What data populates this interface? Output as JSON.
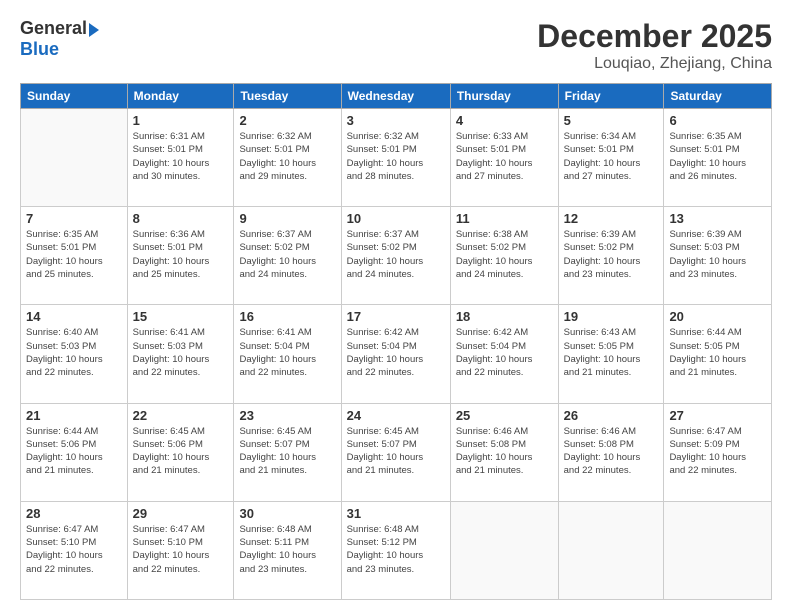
{
  "logo": {
    "general": "General",
    "blue": "Blue"
  },
  "title": "December 2025",
  "subtitle": "Louqiao, Zhejiang, China",
  "header_days": [
    "Sunday",
    "Monday",
    "Tuesday",
    "Wednesday",
    "Thursday",
    "Friday",
    "Saturday"
  ],
  "weeks": [
    [
      {
        "day": "",
        "info": ""
      },
      {
        "day": "1",
        "info": "Sunrise: 6:31 AM\nSunset: 5:01 PM\nDaylight: 10 hours\nand 30 minutes."
      },
      {
        "day": "2",
        "info": "Sunrise: 6:32 AM\nSunset: 5:01 PM\nDaylight: 10 hours\nand 29 minutes."
      },
      {
        "day": "3",
        "info": "Sunrise: 6:32 AM\nSunset: 5:01 PM\nDaylight: 10 hours\nand 28 minutes."
      },
      {
        "day": "4",
        "info": "Sunrise: 6:33 AM\nSunset: 5:01 PM\nDaylight: 10 hours\nand 27 minutes."
      },
      {
        "day": "5",
        "info": "Sunrise: 6:34 AM\nSunset: 5:01 PM\nDaylight: 10 hours\nand 27 minutes."
      },
      {
        "day": "6",
        "info": "Sunrise: 6:35 AM\nSunset: 5:01 PM\nDaylight: 10 hours\nand 26 minutes."
      }
    ],
    [
      {
        "day": "7",
        "info": "Sunrise: 6:35 AM\nSunset: 5:01 PM\nDaylight: 10 hours\nand 25 minutes."
      },
      {
        "day": "8",
        "info": "Sunrise: 6:36 AM\nSunset: 5:01 PM\nDaylight: 10 hours\nand 25 minutes."
      },
      {
        "day": "9",
        "info": "Sunrise: 6:37 AM\nSunset: 5:02 PM\nDaylight: 10 hours\nand 24 minutes."
      },
      {
        "day": "10",
        "info": "Sunrise: 6:37 AM\nSunset: 5:02 PM\nDaylight: 10 hours\nand 24 minutes."
      },
      {
        "day": "11",
        "info": "Sunrise: 6:38 AM\nSunset: 5:02 PM\nDaylight: 10 hours\nand 24 minutes."
      },
      {
        "day": "12",
        "info": "Sunrise: 6:39 AM\nSunset: 5:02 PM\nDaylight: 10 hours\nand 23 minutes."
      },
      {
        "day": "13",
        "info": "Sunrise: 6:39 AM\nSunset: 5:03 PM\nDaylight: 10 hours\nand 23 minutes."
      }
    ],
    [
      {
        "day": "14",
        "info": "Sunrise: 6:40 AM\nSunset: 5:03 PM\nDaylight: 10 hours\nand 22 minutes."
      },
      {
        "day": "15",
        "info": "Sunrise: 6:41 AM\nSunset: 5:03 PM\nDaylight: 10 hours\nand 22 minutes."
      },
      {
        "day": "16",
        "info": "Sunrise: 6:41 AM\nSunset: 5:04 PM\nDaylight: 10 hours\nand 22 minutes."
      },
      {
        "day": "17",
        "info": "Sunrise: 6:42 AM\nSunset: 5:04 PM\nDaylight: 10 hours\nand 22 minutes."
      },
      {
        "day": "18",
        "info": "Sunrise: 6:42 AM\nSunset: 5:04 PM\nDaylight: 10 hours\nand 22 minutes."
      },
      {
        "day": "19",
        "info": "Sunrise: 6:43 AM\nSunset: 5:05 PM\nDaylight: 10 hours\nand 21 minutes."
      },
      {
        "day": "20",
        "info": "Sunrise: 6:44 AM\nSunset: 5:05 PM\nDaylight: 10 hours\nand 21 minutes."
      }
    ],
    [
      {
        "day": "21",
        "info": "Sunrise: 6:44 AM\nSunset: 5:06 PM\nDaylight: 10 hours\nand 21 minutes."
      },
      {
        "day": "22",
        "info": "Sunrise: 6:45 AM\nSunset: 5:06 PM\nDaylight: 10 hours\nand 21 minutes."
      },
      {
        "day": "23",
        "info": "Sunrise: 6:45 AM\nSunset: 5:07 PM\nDaylight: 10 hours\nand 21 minutes."
      },
      {
        "day": "24",
        "info": "Sunrise: 6:45 AM\nSunset: 5:07 PM\nDaylight: 10 hours\nand 21 minutes."
      },
      {
        "day": "25",
        "info": "Sunrise: 6:46 AM\nSunset: 5:08 PM\nDaylight: 10 hours\nand 21 minutes."
      },
      {
        "day": "26",
        "info": "Sunrise: 6:46 AM\nSunset: 5:08 PM\nDaylight: 10 hours\nand 22 minutes."
      },
      {
        "day": "27",
        "info": "Sunrise: 6:47 AM\nSunset: 5:09 PM\nDaylight: 10 hours\nand 22 minutes."
      }
    ],
    [
      {
        "day": "28",
        "info": "Sunrise: 6:47 AM\nSunset: 5:10 PM\nDaylight: 10 hours\nand 22 minutes."
      },
      {
        "day": "29",
        "info": "Sunrise: 6:47 AM\nSunset: 5:10 PM\nDaylight: 10 hours\nand 22 minutes."
      },
      {
        "day": "30",
        "info": "Sunrise: 6:48 AM\nSunset: 5:11 PM\nDaylight: 10 hours\nand 23 minutes."
      },
      {
        "day": "31",
        "info": "Sunrise: 6:48 AM\nSunset: 5:12 PM\nDaylight: 10 hours\nand 23 minutes."
      },
      {
        "day": "",
        "info": ""
      },
      {
        "day": "",
        "info": ""
      },
      {
        "day": "",
        "info": ""
      }
    ]
  ]
}
